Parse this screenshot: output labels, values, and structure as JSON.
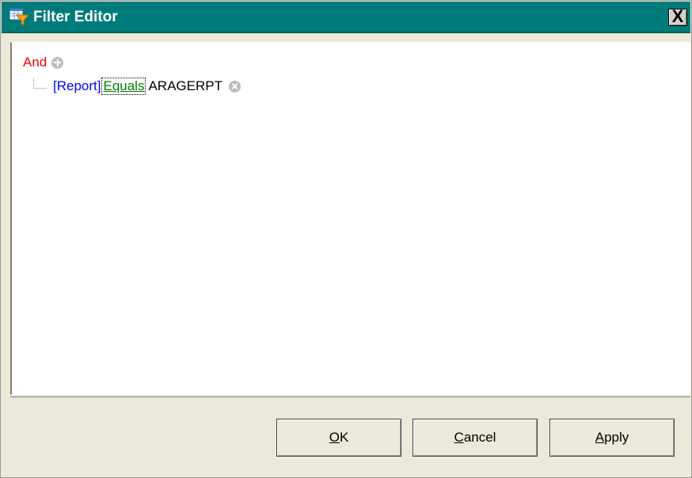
{
  "window": {
    "title": "Filter Editor",
    "close_symbol": "X",
    "title_icon": "filter-editor-icon",
    "colors": {
      "titlebar": "#007b7b",
      "group_operator": "#ff0000",
      "field": "#0000ff",
      "operator": "#008000",
      "value": "#000000"
    }
  },
  "filter": {
    "group_operator": "And",
    "add_icon": "plus-circle-icon",
    "conditions": [
      {
        "field": "[Report]",
        "operator": "Equals",
        "value": "ARAGERPT",
        "remove_icon": "remove-circle-icon"
      }
    ]
  },
  "buttons": {
    "ok": {
      "mnemonic": "O",
      "rest": "K"
    },
    "cancel": {
      "mnemonic": "C",
      "rest": "ancel"
    },
    "apply": {
      "mnemonic": "A",
      "rest": "pply"
    }
  }
}
